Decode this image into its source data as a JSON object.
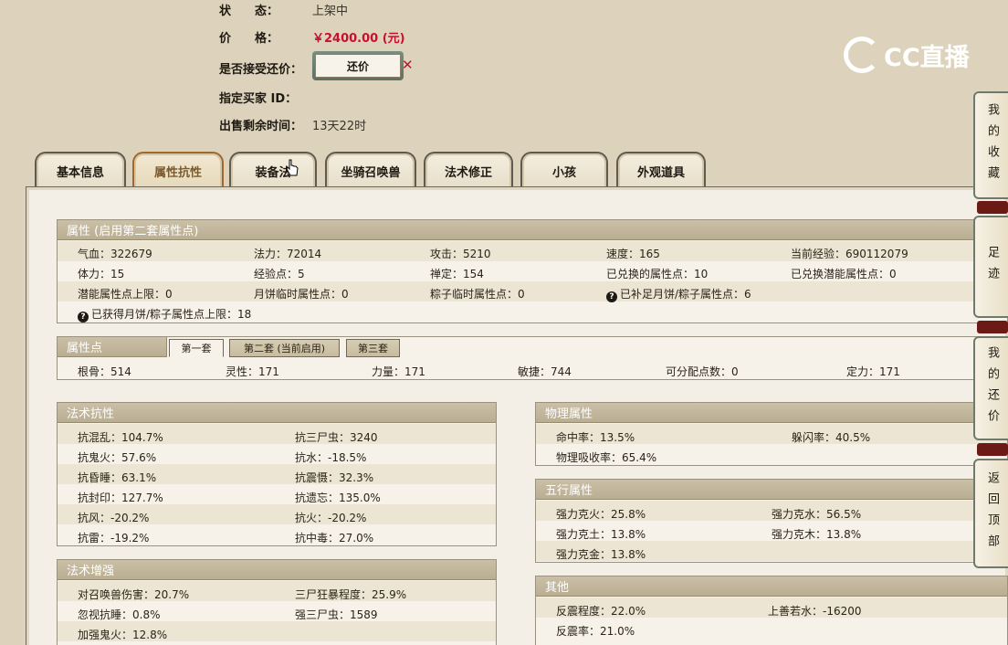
{
  "info": {
    "status_label": "状　　态：",
    "status_value": "上架中",
    "price_label": "价　　格：",
    "price_value": "￥2400.00 (元)",
    "accept_label": "是否接受还价：",
    "bargain_button": "还价",
    "bargain_x": "✕",
    "buyer_label": "指定买家 ID：",
    "remaining_label": "出售剩余时间：",
    "remaining_value": "13天22时"
  },
  "logo": {
    "text": "CC直播"
  },
  "tabs": [
    {
      "label": "基本信息"
    },
    {
      "label": "属性抗性"
    },
    {
      "label": "装备法"
    },
    {
      "label": "坐骑召唤兽"
    },
    {
      "label": "法术修正"
    },
    {
      "label": "小孩"
    },
    {
      "label": "外观道具"
    }
  ],
  "attributes": {
    "title": "属性 (启用第二套属性点)",
    "rows": [
      [
        "气血：322679",
        "法力：72014",
        "攻击：5210",
        "速度：165",
        "当前经验：690112079"
      ],
      [
        "体力：15",
        "经验点：5",
        "禅定：154",
        "已兑换的属性点：10",
        "已兑换潜能属性点：0"
      ],
      [
        "潜能属性点上限：0",
        "月饼临时属性点：0",
        "粽子临时属性点：0",
        "已补足月饼/粽子属性点：6"
      ],
      [
        "已获得月饼/粽子属性点上限：18"
      ]
    ]
  },
  "points": {
    "title": "属性点",
    "subtabs": [
      "第一套",
      "第二套 (当前启用)",
      "第三套"
    ],
    "values": [
      "根骨：514",
      "灵性：171",
      "力量：171",
      "敏捷：744",
      "可分配点数：0",
      "定力：171"
    ]
  },
  "resist": {
    "title": "法术抗性",
    "rows": [
      [
        "抗混乱：104.7%",
        "抗三尸虫：3240"
      ],
      [
        "抗鬼火：57.6%",
        "抗水：-18.5%"
      ],
      [
        "抗昏睡：63.1%",
        "抗震慑：32.3%"
      ],
      [
        "抗封印：127.7%",
        "抗遗忘：135.0%"
      ],
      [
        "抗风：-20.2%",
        "抗火：-20.2%"
      ],
      [
        "抗雷：-19.2%",
        "抗中毒：27.0%"
      ]
    ]
  },
  "enhance": {
    "title": "法术增强",
    "rows": [
      [
        "对召唤兽伤害：20.7%",
        "三尸狂暴程度：25.9%"
      ],
      [
        "忽视抗睡：0.8%",
        "强三尸虫：1589"
      ],
      [
        "加强鬼火：12.8%"
      ]
    ]
  },
  "physical": {
    "title": "物理属性",
    "rows": [
      [
        "命中率：13.5%",
        "躲闪率：40.5%"
      ],
      [
        "物理吸收率：65.4%"
      ]
    ]
  },
  "elements": {
    "title": "五行属性",
    "rows": [
      [
        "强力克火：25.8%",
        "强力克水：56.5%"
      ],
      [
        "强力克土：13.8%",
        "强力克木：13.8%"
      ],
      [
        "强力克金：13.8%"
      ]
    ]
  },
  "other": {
    "title": "其他",
    "rows": [
      [
        "反震程度：22.0%",
        "上善若水：-16200"
      ],
      [
        "反震率：21.0%"
      ]
    ]
  },
  "side": {
    "favorites": "我的收藏",
    "footprints": "足迹",
    "my_bargains": "我的还价",
    "back_top": "返回顶部"
  },
  "colors": {
    "background": "#ddd3bc",
    "price": "#c8102e",
    "active_tab_border": "#a0682c",
    "section_header": "#bfb398"
  }
}
